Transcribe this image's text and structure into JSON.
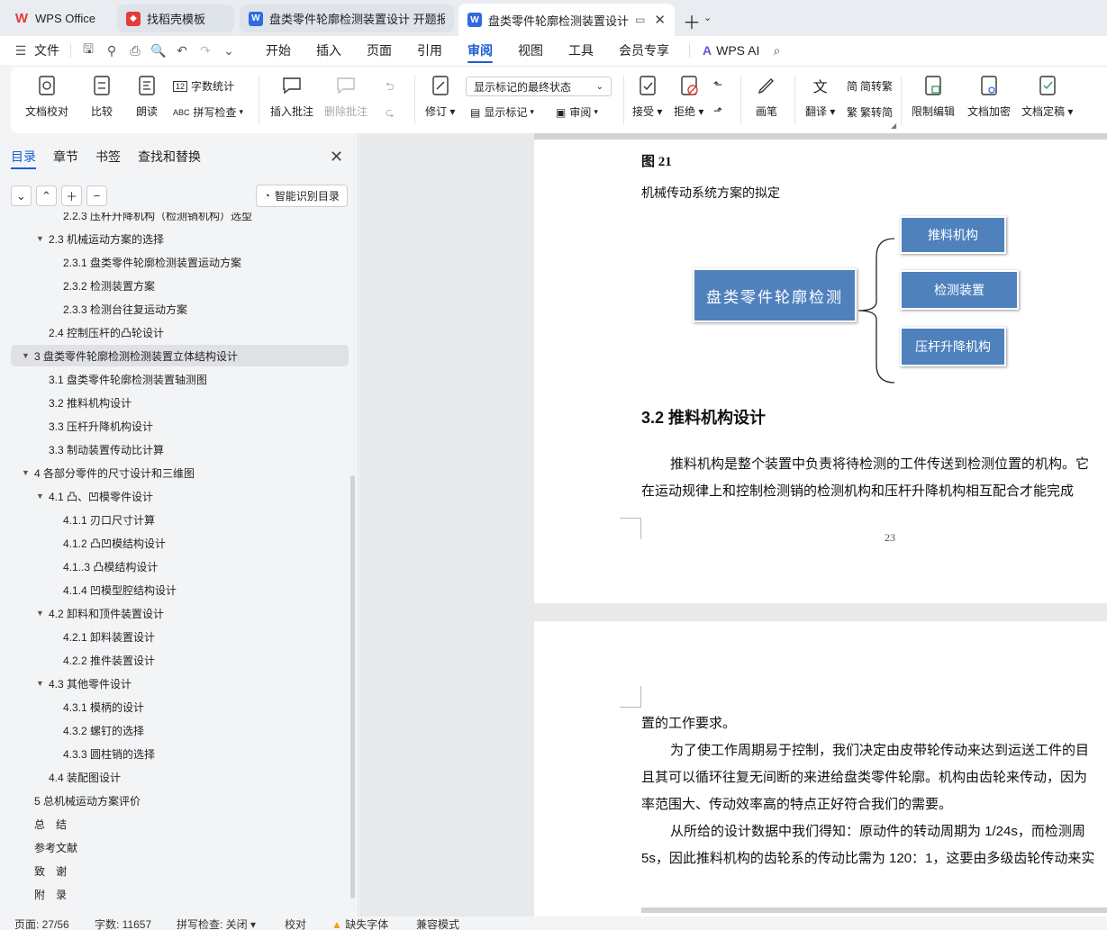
{
  "tabs": [
    {
      "label": "WPS Office",
      "icon": "wps-logo-icon"
    },
    {
      "label": "找稻壳模板",
      "icon": "docer-icon"
    },
    {
      "label": "盘类零件轮廓检测装置设计 开题报告",
      "icon": "word-doc-icon"
    },
    {
      "label": "盘类零件轮廓检测装置设计 说",
      "icon": "word-doc-icon"
    }
  ],
  "menu": {
    "file": "文件",
    "items": [
      "开始",
      "插入",
      "页面",
      "引用",
      "审阅",
      "视图",
      "工具",
      "会员专享"
    ],
    "active": "审阅",
    "ai": "WPS AI"
  },
  "ribbon": {
    "doc_check": "文档校对",
    "compare": "比较",
    "read_aloud": "朗读",
    "word_count": "字数统计",
    "spell_check": "拼写检查",
    "insert_comment": "插入批注",
    "delete_comment": "删除批注",
    "revise": "修订",
    "markup_select": "显示标记的最终状态",
    "show_markup": "显示标记",
    "review": "审阅",
    "accept": "接受",
    "reject": "拒绝",
    "pen": "画笔",
    "translate": "翻译",
    "to_traditional": "简转繁",
    "to_simplified": "繁转简",
    "restrict_edit": "限制编辑",
    "encrypt": "文档加密",
    "finalize": "文档定稿"
  },
  "sidebar": {
    "tabs": [
      "目录",
      "章节",
      "书签",
      "查找和替换"
    ],
    "smart_btn": "智能识别目录",
    "toc": [
      {
        "label": "2.2.3 压杆升降机构（检测销机构）选型",
        "level": 3,
        "arrow": false
      },
      {
        "label": "2.3 机械运动方案的选择",
        "level": 2,
        "arrow": true
      },
      {
        "label": "2.3.1 盘类零件轮廓检测装置运动方案",
        "level": 3,
        "arrow": false
      },
      {
        "label": "2.3.2 检测装置方案",
        "level": 3,
        "arrow": false
      },
      {
        "label": "2.3.3 检测台往复运动方案",
        "level": 3,
        "arrow": false
      },
      {
        "label": "2.4 控制压杆的凸轮设计",
        "level": 2,
        "arrow": false
      },
      {
        "label": "3 盘类零件轮廓检测检测装置立体结构设计",
        "level": 1,
        "arrow": true,
        "selected": true
      },
      {
        "label": "3.1 盘类零件轮廓检测装置轴测图",
        "level": 2,
        "arrow": false
      },
      {
        "label": "3.2 推料机构设计",
        "level": 2,
        "arrow": false
      },
      {
        "label": "3.3 压杆升降机构设计",
        "level": 2,
        "arrow": false
      },
      {
        "label": "3.3 制动装置传动比计算",
        "level": 2,
        "arrow": false
      },
      {
        "label": "4 各部分零件的尺寸设计和三维图",
        "level": 1,
        "arrow": true
      },
      {
        "label": "4.1 凸、凹模零件设计",
        "level": 2,
        "arrow": true
      },
      {
        "label": "4.1.1 刃口尺寸计算",
        "level": 3,
        "arrow": false
      },
      {
        "label": "4.1.2 凸凹模结构设计",
        "level": 3,
        "arrow": false
      },
      {
        "label": "4.1..3 凸模结构设计",
        "level": 3,
        "arrow": false
      },
      {
        "label": "4.1.4 凹模型腔结构设计",
        "level": 3,
        "arrow": false
      },
      {
        "label": "4.2 卸料和顶件装置设计",
        "level": 2,
        "arrow": true
      },
      {
        "label": "4.2.1 卸料装置设计",
        "level": 3,
        "arrow": false
      },
      {
        "label": "4.2.2 推件装置设计",
        "level": 3,
        "arrow": false
      },
      {
        "label": "4.3 其他零件设计",
        "level": 2,
        "arrow": true
      },
      {
        "label": "4.3.1 模柄的设计",
        "level": 3,
        "arrow": false
      },
      {
        "label": "4.3.2 螺钉的选择",
        "level": 3,
        "arrow": false
      },
      {
        "label": "4.3.3 圆柱销的选择",
        "level": 3,
        "arrow": false
      },
      {
        "label": "4.4 装配图设计",
        "level": 2,
        "arrow": false
      },
      {
        "label": "5 总机械运动方案评价",
        "level": 1,
        "arrow": false
      },
      {
        "label": "总　结",
        "level": 1,
        "arrow": false
      },
      {
        "label": "参考文献",
        "level": 1,
        "arrow": false
      },
      {
        "label": "致　谢",
        "level": 1,
        "arrow": false
      },
      {
        "label": "附　录",
        "level": 1,
        "arrow": false
      }
    ]
  },
  "document": {
    "fig_label": "图 21",
    "fig_caption": "机械传动系统方案的拟定",
    "diagram": {
      "root": "盘类零件轮廓检测",
      "children": [
        "推料机构",
        "检测装置",
        "压杆升降机构"
      ]
    },
    "heading": "3.2 推料机构设计",
    "para1_l1": "推料机构是整个装置中负责将待检测的工件传送到检测位置的机构。它",
    "para1_l2": "在运动规律上和控制检测销的检测机构和压杆升降机构相互配合才能完成",
    "page_number": "23",
    "p2_l1": "置的工作要求。",
    "p2_l2": "为了使工作周期易于控制，我们决定由皮带轮传动来达到运送工件的目",
    "p2_l3": "且其可以循环往复无间断的来进给盘类零件轮廓。机构由齿轮来传动，因为",
    "p2_l4": "率范围大、传动效率高的特点正好符合我们的需要。",
    "p2_l5": "从所给的设计数据中我们得知：原动件的转动周期为 1/24s，而检测周",
    "p2_l6": "5s，因此推料机构的齿轮系的传动比需为 120：1，这要由多级齿轮传动来实"
  },
  "status": {
    "page": "页面: 27/56",
    "words": "字数: 11657",
    "spell": "拼写检查: 关闭",
    "proof": "校对",
    "missing_font": "缺失字体",
    "compat": "兼容模式"
  },
  "colors": {
    "accent": "#1d5cd6",
    "diagram_box": "#4f81bd",
    "wps_red": "#e23b3b",
    "word_blue": "#2f6ae0"
  }
}
